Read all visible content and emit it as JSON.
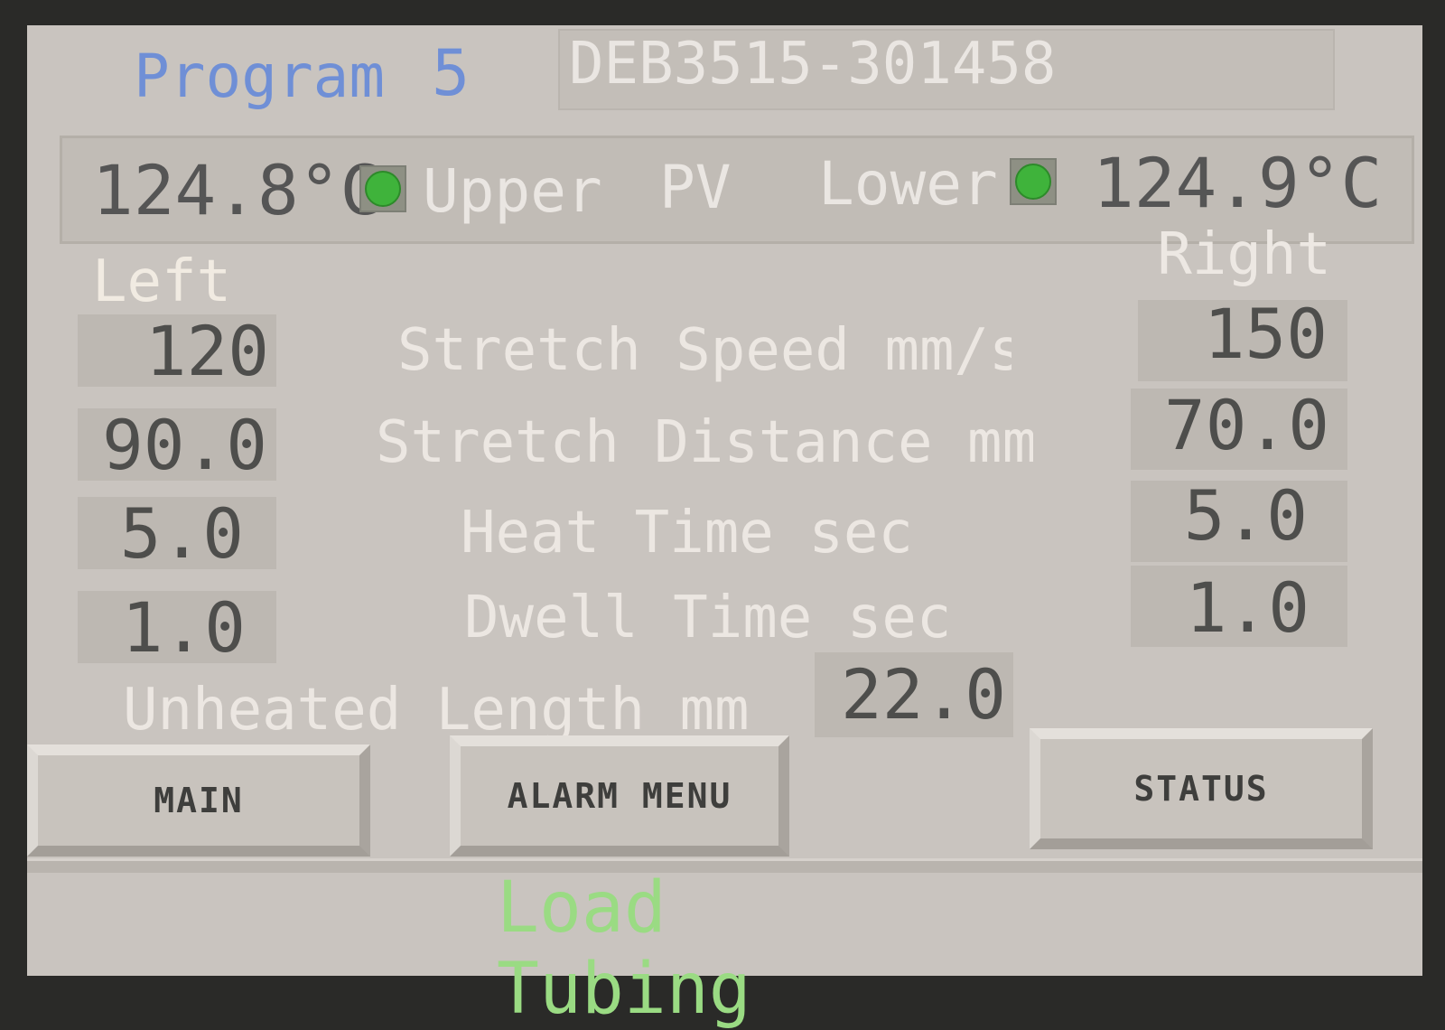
{
  "header": {
    "program_label": "Program",
    "program_number": "5",
    "program_id": "DEB3515-301458"
  },
  "pv": {
    "upper_value": "124.8°C",
    "upper_label": "Upper",
    "center_label": "PV",
    "lower_label": "Lower",
    "lower_value": "124.9°C",
    "upper_indicator": "on",
    "lower_indicator": "on",
    "indicator_color": "#3fb33b"
  },
  "sides": {
    "left": "Left",
    "right": "Right"
  },
  "rows": [
    {
      "label": "Stretch Speed mm/s",
      "left": "120",
      "right": "150"
    },
    {
      "label": "Stretch Distance mm",
      "left": "90.0",
      "right": "70.0"
    },
    {
      "label": "Heat Time sec",
      "left": "5.0",
      "right": "5.0"
    },
    {
      "label": "Dwell Time sec",
      "left": "1.0",
      "right": "1.0"
    }
  ],
  "unheated": {
    "label": "Unheated Length mm",
    "value": "22.0"
  },
  "buttons": {
    "main": "MAIN",
    "alarm_menu": "ALARM MENU",
    "status": "STATUS"
  },
  "status_message": "Load Tubing"
}
